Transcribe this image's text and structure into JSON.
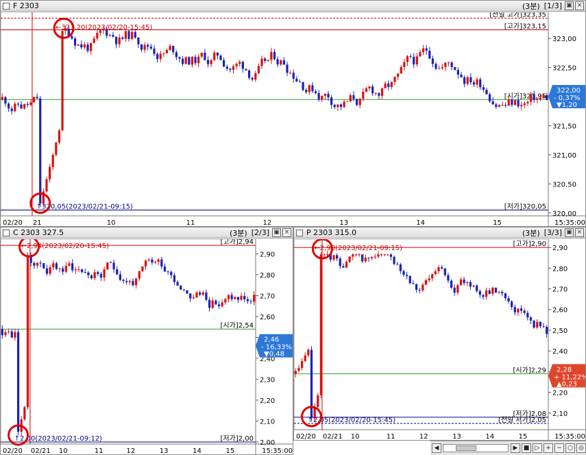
{
  "panels": [
    {
      "title": "F 2303",
      "interval": "(3분)",
      "page": "[1/3]",
      "axis_labels": [
        "323,00",
        "322,50",
        "322,00",
        "321,50",
        "321,00",
        "320,50",
        "320,00"
      ],
      "axis_values": [
        323.0,
        322.5,
        322.0,
        321.5,
        321.0,
        320.5,
        320.0
      ],
      "y_range": [
        319.95,
        323.45
      ],
      "x_labels": [
        {
          "t": "02/20",
          "x": 0.0
        },
        {
          "t": "21",
          "x": 0.055
        },
        {
          "t": "10",
          "x": 0.19
        },
        {
          "t": "11",
          "x": 0.335
        },
        {
          "t": "12",
          "x": 0.475
        },
        {
          "t": "13",
          "x": 0.615
        },
        {
          "t": "14",
          "x": 0.755
        },
        {
          "t": "15",
          "x": 0.895
        }
      ],
      "time_label": "15:35:00",
      "lines": [
        {
          "label": "[전일 고가]323,35",
          "value": 323.35,
          "color": "#cc0000",
          "style": "dash"
        },
        {
          "label": "[고가]323,15",
          "value": 323.15,
          "color": "#cc0000",
          "style": "solid"
        },
        {
          "label": "[시가]321,95",
          "value": 321.95,
          "color": "#2e9a2e",
          "style": "solid"
        },
        {
          "label": "[저가]320,05",
          "value": 320.05,
          "color": "#000080",
          "style": "solid"
        }
      ],
      "high_note": "323,20(2023/02/20-15:45)",
      "high_value": 323.2,
      "low_note": "320,05(2023/02/21-09:15)",
      "low_value": 320.05,
      "tag": {
        "price": "322,00",
        "change": "- 0,37%",
        "delta": "▼1,20",
        "color": "#2c78d8",
        "value": 322.0
      },
      "seed": 11
    },
    {
      "title": "C 2303 327.5",
      "interval": "(3분)",
      "page": "[2/3]",
      "axis_labels": [
        "2,90",
        "2,80",
        "2,70",
        "2,60",
        "2,50",
        "2,40",
        "2,30",
        "2,20",
        "2,10",
        "2,00"
      ],
      "axis_values": [
        2.9,
        2.8,
        2.7,
        2.6,
        2.5,
        2.4,
        2.3,
        2.2,
        2.1,
        2.0
      ],
      "y_range": [
        1.99,
        2.97
      ],
      "x_labels": [
        {
          "t": "02/20",
          "x": 0.0
        },
        {
          "t": "02/21",
          "x": 0.11
        },
        {
          "t": "10",
          "x": 0.22
        },
        {
          "t": "11",
          "x": 0.36
        },
        {
          "t": "12",
          "x": 0.485
        },
        {
          "t": "13",
          "x": 0.615
        },
        {
          "t": "14",
          "x": 0.745
        },
        {
          "t": "15",
          "x": 0.875
        }
      ],
      "time_label": "15:35:00",
      "lines": [
        {
          "label": "[고가]2,94",
          "value": 2.94,
          "color": "#cc0000",
          "style": "solid"
        },
        {
          "label": "[시가]2,54",
          "value": 2.54,
          "color": "#2e9a2e",
          "style": "solid"
        },
        {
          "label": "[저가]2,00",
          "value": 2.0,
          "color": "#000080",
          "style": "solid"
        }
      ],
      "high_note": "2,94(2023/02/20-15:45)",
      "high_value": 2.94,
      "low_note": "2,00(2023/02/21-09:12)",
      "low_value": 2.0,
      "tag": {
        "price": "2,46",
        "change": "- 16,33%",
        "delta": "▼0,48",
        "color": "#2c78d8",
        "value": 2.46
      },
      "seed": 23
    },
    {
      "title": "P 2303 315.0",
      "interval": "(3분)",
      "page": "[3/3]",
      "axis_labels": [
        "2,90",
        "2,80",
        "2,70",
        "2,60",
        "2,50",
        "2,40",
        "2,30",
        "2,20",
        "2,10"
      ],
      "axis_values": [
        2.9,
        2.8,
        2.7,
        2.6,
        2.5,
        2.4,
        2.3,
        2.2,
        2.1
      ],
      "y_range": [
        2.02,
        2.94
      ],
      "x_labels": [
        {
          "t": "02/20",
          "x": 0.0
        },
        {
          "t": "02/21",
          "x": 0.105
        },
        {
          "t": "10",
          "x": 0.215
        },
        {
          "t": "11",
          "x": 0.355
        },
        {
          "t": "12",
          "x": 0.485
        },
        {
          "t": "13",
          "x": 0.615
        },
        {
          "t": "14",
          "x": 0.745
        },
        {
          "t": "15",
          "x": 0.875
        }
      ],
      "time_label": "15:35:00",
      "lines": [
        {
          "label": "[고가]2,90",
          "value": 2.9,
          "color": "#cc0000",
          "style": "solid"
        },
        {
          "label": "[시가]2,29",
          "value": 2.29,
          "color": "#2e9a2e",
          "style": "solid"
        },
        {
          "label": "[저가]2,08",
          "value": 2.08,
          "color": "#000080",
          "style": "solid"
        },
        {
          "label": "[전일 저가]2,05",
          "value": 2.05,
          "color": "#000080",
          "style": "dash"
        }
      ],
      "high_note": "2,90(2023/02/21-09:15)",
      "high_value": 2.9,
      "low_note": "2,05(2023/02/20-15:45)",
      "low_value": 2.05,
      "tag": {
        "price": "2,28",
        "change": "+ 11,22%",
        "delta": "▲0,23",
        "color": "#e0452a",
        "value": 2.28
      },
      "seed": 37
    }
  ],
  "chart_data": [
    {
      "type": "candlestick",
      "title": "F 2303",
      "ylim": [
        320.0,
        323.0
      ],
      "reference_lines": {
        "전일 고가": 323.35,
        "고가": 323.15,
        "시가": 321.95,
        "저가": 320.05
      },
      "last": 322.0,
      "change_pct": -0.37,
      "change": -1.2
    },
    {
      "type": "candlestick",
      "title": "C 2303 327.5",
      "ylim": [
        2.0,
        2.9
      ],
      "reference_lines": {
        "고가": 2.94,
        "시가": 2.54,
        "저가": 2.0
      },
      "last": 2.46,
      "change_pct": -16.33,
      "change": -0.48
    },
    {
      "type": "candlestick",
      "title": "P 2303 315.0",
      "ylim": [
        2.1,
        2.9
      ],
      "reference_lines": {
        "고가": 2.9,
        "시가": 2.29,
        "저가": 2.08,
        "전일 저가": 2.05
      },
      "last": 2.28,
      "change_pct": 11.22,
      "change": 0.23
    }
  ],
  "colors": {
    "up": "#dd1111",
    "down": "#1c22b8",
    "highlight_circle": "#dd0000",
    "open_line": "#2e9a2e"
  },
  "icons": {
    "close": "×",
    "maximize": "▣"
  }
}
